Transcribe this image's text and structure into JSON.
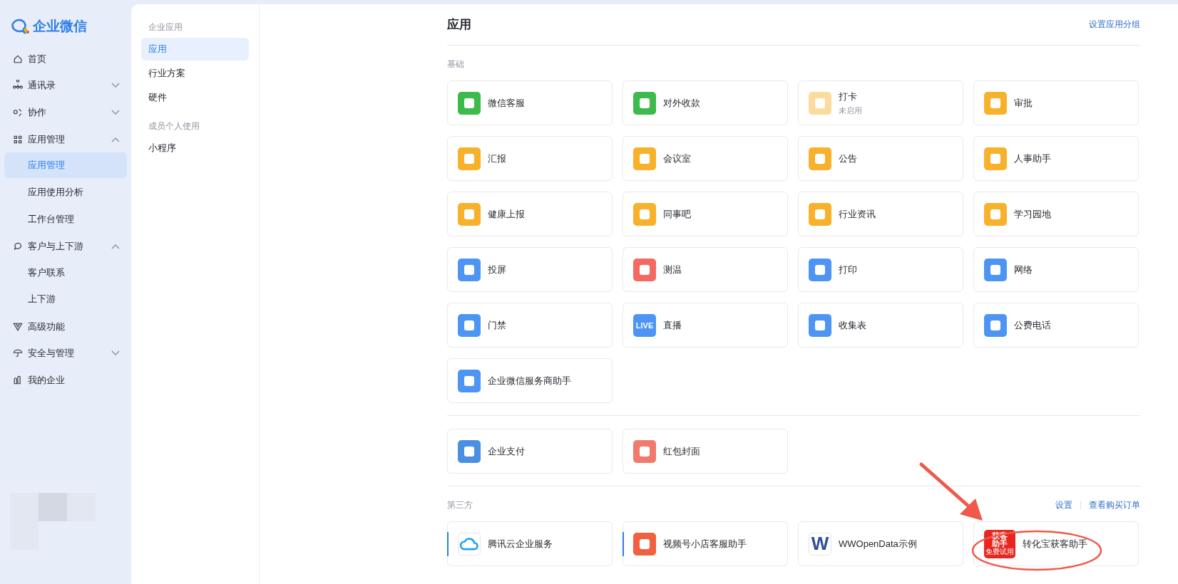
{
  "brand": {
    "name": "企业微信"
  },
  "sidebar": {
    "items": [
      {
        "label": "首页",
        "kind": "link"
      },
      {
        "label": "通讯录",
        "kind": "group",
        "expanded": false
      },
      {
        "label": "协作",
        "kind": "group",
        "expanded": false
      },
      {
        "label": "应用管理",
        "kind": "group",
        "expanded": true,
        "children": [
          {
            "label": "应用管理",
            "selected": true
          },
          {
            "label": "应用使用分析",
            "selected": false
          },
          {
            "label": "工作台管理",
            "selected": false
          }
        ]
      },
      {
        "label": "客户与上下游",
        "kind": "group",
        "expanded": true,
        "children": [
          {
            "label": "客户联系",
            "selected": false
          },
          {
            "label": "上下游",
            "selected": false
          }
        ]
      },
      {
        "label": "高级功能",
        "kind": "link"
      },
      {
        "label": "安全与管理",
        "kind": "group",
        "expanded": false
      },
      {
        "label": "我的企业",
        "kind": "link"
      }
    ]
  },
  "subnav": {
    "groups": [
      {
        "title": "企业应用",
        "items": [
          {
            "label": "应用",
            "selected": true
          },
          {
            "label": "行业方案",
            "selected": false
          },
          {
            "label": "硬件",
            "selected": false
          }
        ]
      },
      {
        "title": "成员个人使用",
        "items": [
          {
            "label": "小程序",
            "selected": false
          }
        ]
      }
    ]
  },
  "page": {
    "title": "应用",
    "action": "设置应用分组"
  },
  "sections": [
    {
      "title": "基础",
      "apps": [
        {
          "name": "微信客服",
          "color": "#3cba4c",
          "kind": "glyph"
        },
        {
          "name": "对外收款",
          "color": "#3cba4c",
          "kind": "glyph"
        },
        {
          "name": "打卡",
          "status": "未启用",
          "color": "#fcdc9e",
          "kind": "glyph"
        },
        {
          "name": "审批",
          "color": "#f7b12a",
          "kind": "glyph"
        },
        {
          "name": "汇报",
          "color": "#f7b12a",
          "kind": "glyph"
        },
        {
          "name": "会议室",
          "color": "#f7b12a",
          "kind": "glyph"
        },
        {
          "name": "公告",
          "color": "#f7b12a",
          "kind": "glyph"
        },
        {
          "name": "人事助手",
          "color": "#f7b12a",
          "kind": "glyph"
        },
        {
          "name": "健康上报",
          "color": "#f7b12a",
          "kind": "glyph"
        },
        {
          "name": "同事吧",
          "color": "#f7b12a",
          "kind": "glyph"
        },
        {
          "name": "行业资讯",
          "color": "#f7b12a",
          "kind": "glyph"
        },
        {
          "name": "学习园地",
          "color": "#f7b12a",
          "kind": "glyph"
        },
        {
          "name": "投屏",
          "color": "#4e95f3",
          "kind": "glyph"
        },
        {
          "name": "测温",
          "color": "#f46a63",
          "kind": "glyph"
        },
        {
          "name": "打印",
          "color": "#4e95f3",
          "kind": "glyph"
        },
        {
          "name": "网络",
          "color": "#4e95f3",
          "kind": "glyph"
        },
        {
          "name": "门禁",
          "color": "#4e95f3",
          "kind": "glyph"
        },
        {
          "name": "直播",
          "color": "#4e95f3",
          "kind": "text",
          "icon_text": "LIVE"
        },
        {
          "name": "收集表",
          "color": "#4e95f3",
          "kind": "glyph"
        },
        {
          "name": "公费电话",
          "color": "#4e95f3",
          "kind": "glyph"
        },
        {
          "name": "企业微信服务商助手",
          "color": "#4e95f3",
          "kind": "glyph"
        }
      ]
    },
    {
      "apps": [
        {
          "name": "企业支付",
          "color": "#4a90e2",
          "kind": "glyph"
        },
        {
          "name": "红包封面",
          "color": "#f07a6e",
          "kind": "glyph"
        }
      ]
    },
    {
      "title": "第三方",
      "links": [
        "设置",
        "查看购买订单"
      ],
      "apps": [
        {
          "name": "腾讯云企业服务",
          "color": "#ffffff",
          "kind": "cloud",
          "accent": true
        },
        {
          "name": "视频号小店客服助手",
          "color": "#f2613f",
          "kind": "glyph",
          "accent": true
        },
        {
          "name": "WWOpenData示例",
          "color": "#ffffff",
          "kind": "text",
          "icon_text": "W",
          "accent": false
        },
        {
          "name": "转化宝获客助手",
          "color": "#e8261e",
          "kind": "badge",
          "icon_lines": [
            "获客",
            "助手",
            "免费试用"
          ],
          "accent": false
        }
      ]
    }
  ]
}
